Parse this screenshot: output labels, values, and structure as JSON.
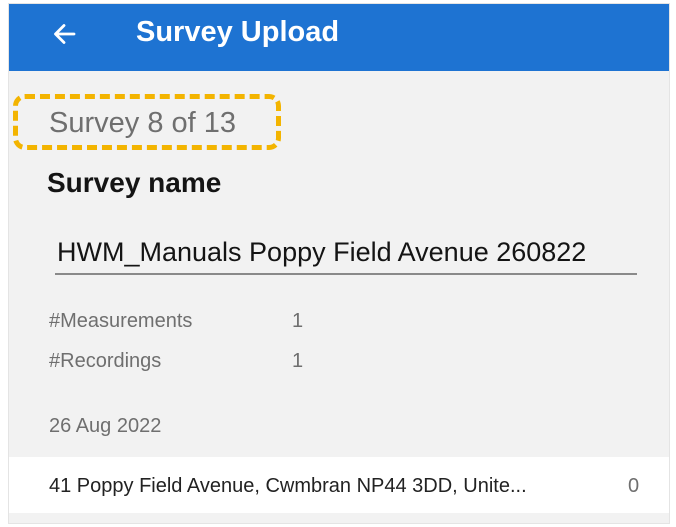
{
  "appbar": {
    "title": "Survey Upload",
    "back_icon": "arrow-left-icon",
    "background_color": "#1e73d2"
  },
  "survey": {
    "counter_label": "Survey 8 of 13",
    "counter_highlight_color": "#f3b400",
    "name_heading": "Survey name",
    "name_value": "HWM_Manuals Poppy Field Avenue 260822",
    "stats": [
      {
        "label": "#Measurements",
        "value": "1"
      },
      {
        "label": "#Recordings",
        "value": "1"
      }
    ],
    "date": "26 Aug 2022"
  },
  "locations": [
    {
      "address": "41 Poppy Field Avenue, Cwmbran NP44 3DD, Unite...",
      "count": "0"
    }
  ]
}
